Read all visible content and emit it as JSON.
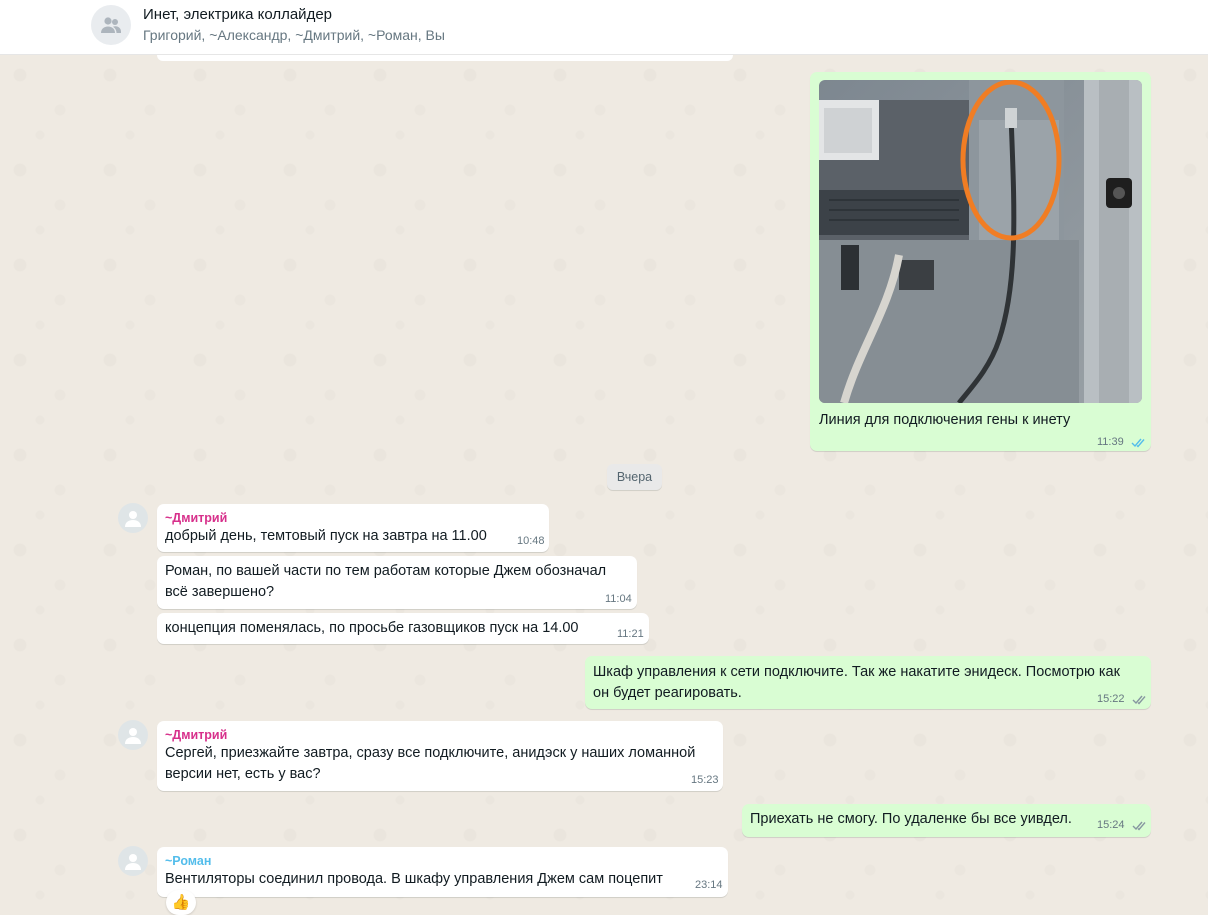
{
  "header": {
    "title": "Инет, электрика коллайдер",
    "subtitle": "Григорий, ~Александр, ~Дмитрий, ~Роман, Вы"
  },
  "colors": {
    "dmitry": "#d7308b",
    "roman": "#53bdeb",
    "outgoing_bubble": "#d9fdd3",
    "incoming_bubble": "#ffffff",
    "read_ticks": "#53bdeb"
  },
  "messages": {
    "photo": {
      "caption": "Линия для подключения гены к инету",
      "time": "11:39"
    },
    "date_chip": "Вчера",
    "m1": {
      "sender": "~Дмитрий",
      "text": "добрый день, темтовый пуск на завтра на 11.00",
      "time": "10:48"
    },
    "m2": {
      "line1": "Роман, по вашей части по тем работам которые Джем обозначал",
      "line2": "всё завершено?",
      "time": "11:04"
    },
    "m3": {
      "text": "концепция поменялась, по просьбе газовщиков пуск на 14.00",
      "time": "11:21"
    },
    "m4": {
      "line1": "Шкаф управления к сети подключите. Так же накатите энидеск. Посмотрю как",
      "line2": "он будет реагировать.",
      "time": "15:22"
    },
    "m5": {
      "sender": "~Дмитрий",
      "line1": "Сергей, приезжайте завтра, сразу все подключите, анидэск у наших ломанной",
      "line2": "версии нет, есть у вас?",
      "time": "15:23"
    },
    "m6": {
      "text": "Приехать не смогу. По удаленке бы все уивдел.",
      "time": "15:24"
    },
    "m7": {
      "sender": "~Роман",
      "text": "Вентиляторы соединил провода. В шкафу управления Джем сам поцепит",
      "time": "23:14",
      "reaction": "👍"
    }
  }
}
